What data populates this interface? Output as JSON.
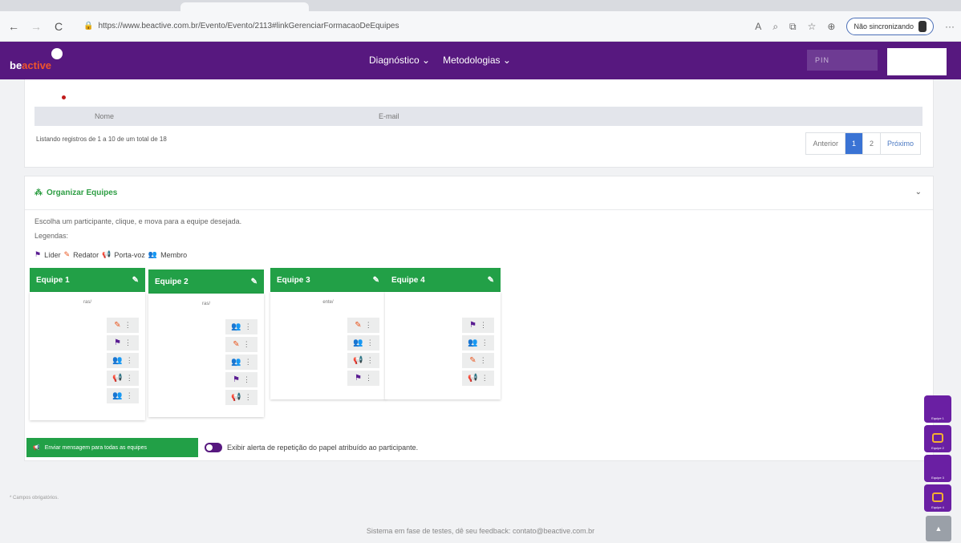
{
  "browser": {
    "url": "https://www.beactive.com.br/Evento/Evento/2113#linkGerenciarFormacaoDeEquipes",
    "sync_label": "Não sincronizando"
  },
  "navbar": {
    "logo_be": "be",
    "logo_active": "active",
    "menu": [
      "Diagnóstico",
      "Metodologias"
    ],
    "pin_placeholder": "PIN"
  },
  "participants": {
    "columns": [
      "Nome",
      "E-mail"
    ],
    "listing_text": "Listando registros de 1 a 10 de um total de 18",
    "pager": {
      "prev": "Anterior",
      "pages": [
        "1",
        "2"
      ],
      "active_page": "1",
      "next": "Próximo"
    }
  },
  "organize": {
    "title": "Organizar Equipes",
    "instruction": "Escolha um participante, clique, e mova para a equipe desejada.",
    "legend_title": "Legendas:",
    "legend": [
      "Líder",
      "Redator",
      "Porta-voz",
      "Membro"
    ],
    "teams": [
      {
        "name": "Equipe 1",
        "top_text": "ras/",
        "roles": [
          "redator",
          "lider",
          "membro",
          "porta",
          "membro"
        ]
      },
      {
        "name": "Equipe 2",
        "top_text": "ras/",
        "roles": [
          "membro",
          "redator",
          "membro",
          "lider",
          "porta"
        ]
      },
      {
        "name": "Equipe 3",
        "top_text": "ente/",
        "roles": [
          "redator",
          "membro",
          "porta",
          "lider"
        ]
      },
      {
        "name": "Equipe 4",
        "top_text": "",
        "roles": [
          "lider",
          "membro",
          "redator",
          "porta"
        ]
      }
    ],
    "send_button": "Enviar mensagem para todas as equipes",
    "toggle_label": "Exibir alerta de repetição do papel atribuído ao participante."
  },
  "footer": {
    "required_note": "* Campos obrigatórios.",
    "feedback": "Sistema em fase de testes, dê seu feedback: contato@beactive.com.br"
  },
  "side_buttons": [
    "Equipe 1",
    "Equipe 2",
    "Equipe 3",
    "Equipe 4"
  ],
  "colors": {
    "purple": "#57187f",
    "green": "#22a047",
    "orange": "#e9541d",
    "teal": "#19b3b3"
  }
}
